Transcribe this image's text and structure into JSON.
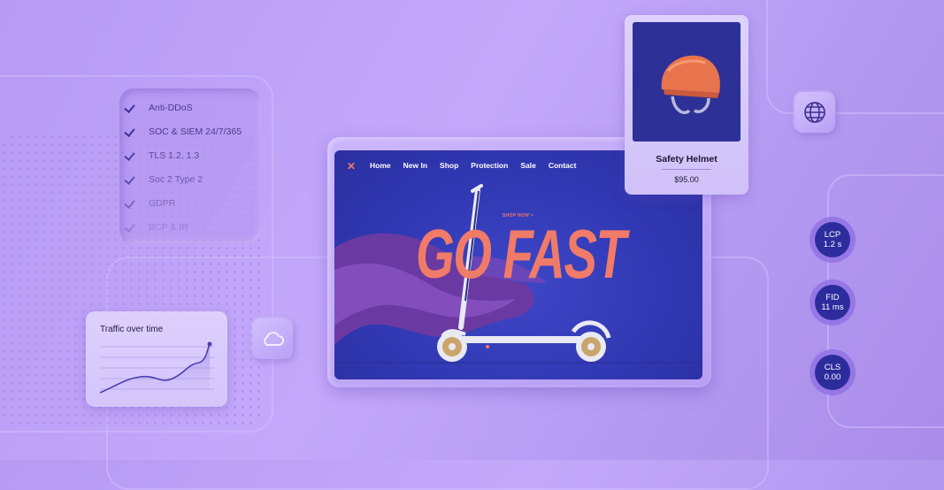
{
  "checklist": {
    "items": [
      "Anti-DDoS",
      "SOC & SIEM 24/7/365",
      "TLS 1.2, 1.3",
      "Soc 2 Type 2",
      "GDPR",
      "BCP & IR"
    ]
  },
  "traffic_card": {
    "title": "Traffic over time"
  },
  "site": {
    "nav": [
      "Home",
      "New In",
      "Shop",
      "Protection",
      "Sale",
      "Contact"
    ],
    "cta": "SHOP NOW >",
    "headline": "GO FAST"
  },
  "product": {
    "name": "Safety Helmet",
    "price": "$95.00"
  },
  "metrics": [
    {
      "label": "LCP",
      "value": "1.2 s"
    },
    {
      "label": "FID",
      "value": "11 ms"
    },
    {
      "label": "CLS",
      "value": "0.00"
    }
  ],
  "colors": {
    "accent": "#f07b68",
    "navy": "#2d2c9c",
    "lavender": "#c4a9fb"
  },
  "icons": [
    "check-icon",
    "cloud-icon",
    "globe-icon",
    "brand-logo-icon"
  ]
}
